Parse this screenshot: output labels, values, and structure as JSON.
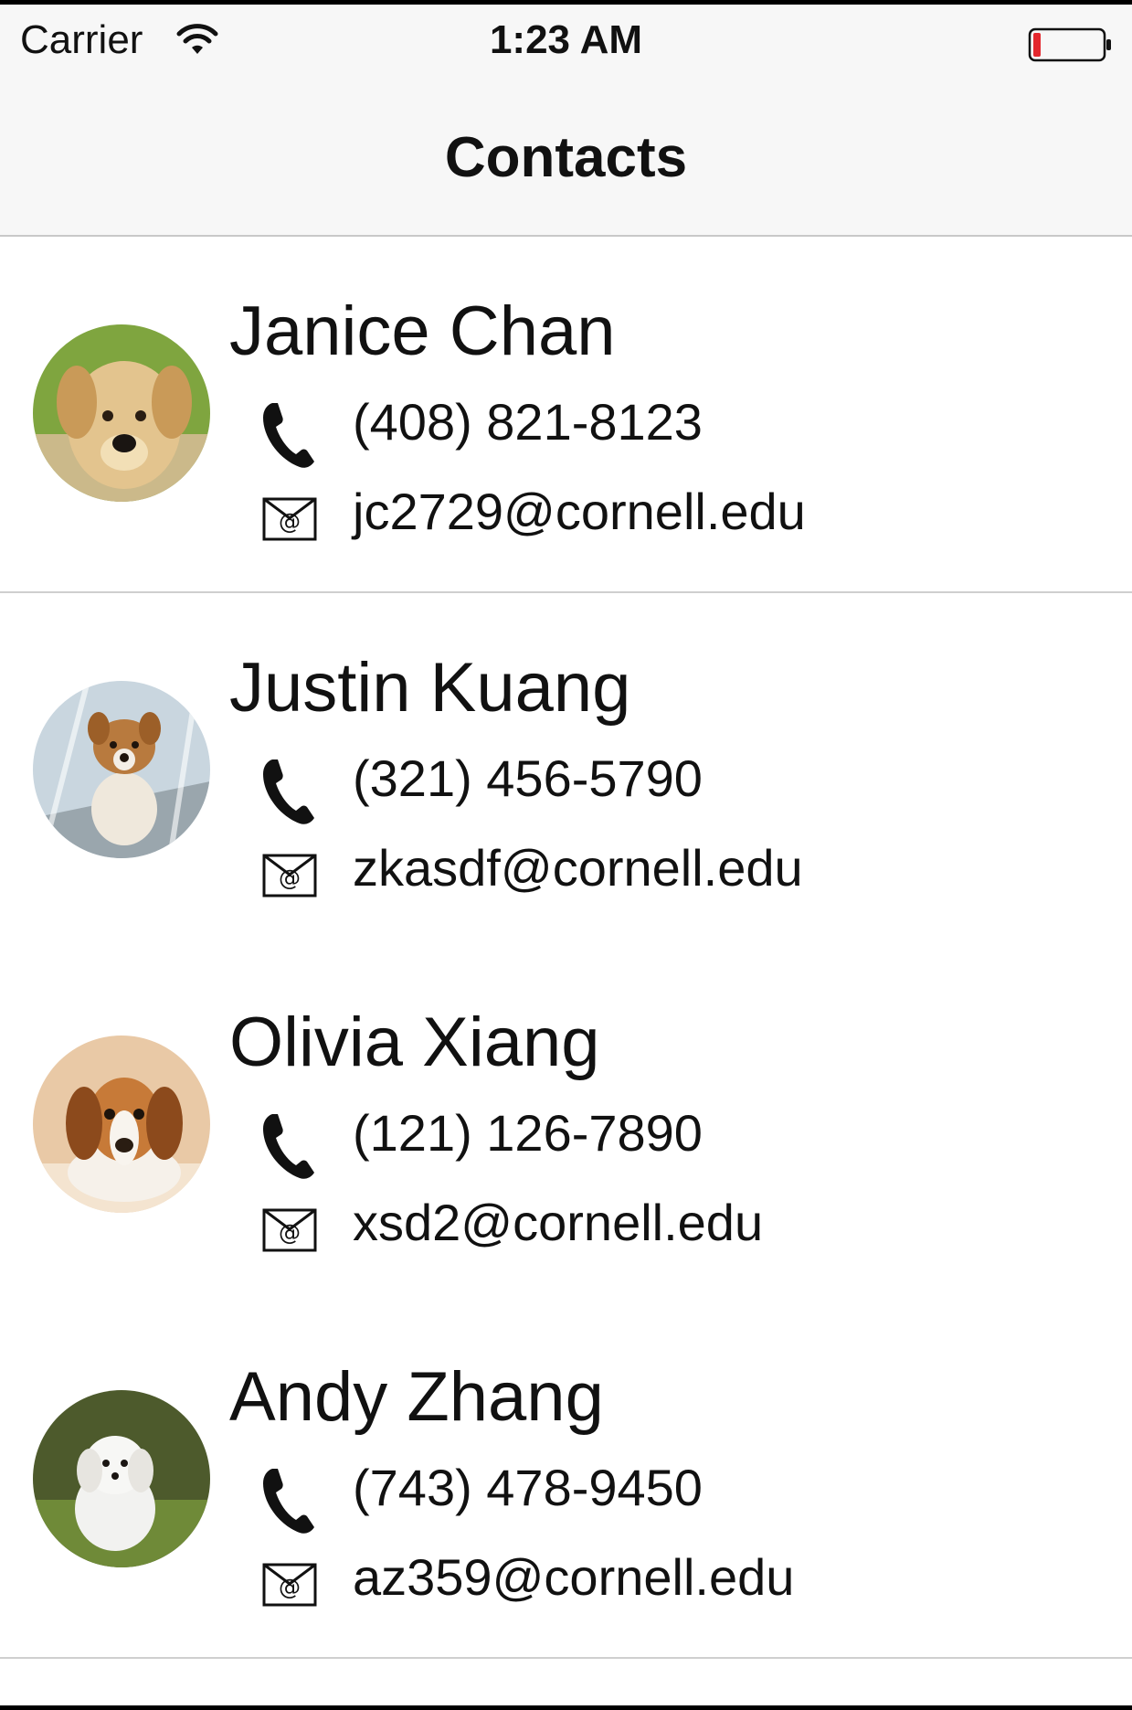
{
  "status_bar": {
    "carrier": "Carrier",
    "time": "1:23 AM",
    "wifi_icon": "wifi-icon",
    "battery_icon": "battery-icon",
    "battery_color": "#e4262c"
  },
  "nav": {
    "title": "Contacts"
  },
  "contacts": [
    {
      "name": "Janice Chan",
      "phone": "(408) 821-8123",
      "email": "jc2729@cornell.edu",
      "avatar": "puppy-labrador-photo"
    },
    {
      "name": "Justin Kuang",
      "phone": "(321) 456-5790",
      "email": "zkasdf@cornell.edu",
      "avatar": "puppy-corgi-photo"
    },
    {
      "name": "Olivia Xiang",
      "phone": "(121) 126-7890",
      "email": "xsd2@cornell.edu",
      "avatar": "puppy-beagle-photo"
    },
    {
      "name": "Andy Zhang",
      "phone": "(743) 478-9450",
      "email": "az359@cornell.edu",
      "avatar": "puppy-white-maltese-photo"
    }
  ],
  "icons": {
    "phone": "phone-icon",
    "mail": "mail-icon"
  }
}
